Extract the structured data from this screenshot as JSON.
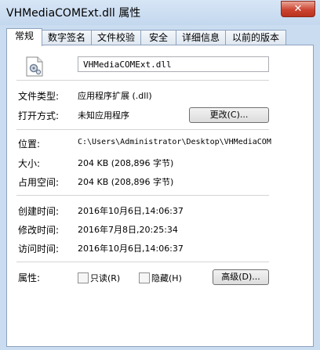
{
  "window": {
    "title": "VHMediaCOMExt.dll 属性",
    "close_label": "✕"
  },
  "tabs": [
    {
      "label": "常规"
    },
    {
      "label": "数字签名"
    },
    {
      "label": "文件校验"
    },
    {
      "label": "安全"
    },
    {
      "label": "详细信息"
    },
    {
      "label": "以前的版本"
    }
  ],
  "general": {
    "filename": "VHMediaCOMExt.dll",
    "file_type_label": "文件类型:",
    "file_type_value": "应用程序扩展 (.dll)",
    "open_with_label": "打开方式:",
    "open_with_value": "未知应用程序",
    "change_button": "更改(C)...",
    "location_label": "位置:",
    "location_value": "C:\\Users\\Administrator\\Desktop\\VHMediaCOM",
    "size_label": "大小:",
    "size_value": "204 KB (208,896 字节)",
    "size_on_disk_label": "占用空间:",
    "size_on_disk_value": "204 KB (208,896 字节)",
    "created_label": "创建时间:",
    "created_value": "2016年10月6日,14:06:37",
    "modified_label": "修改时间:",
    "modified_value": "2016年7月8日,20:25:34",
    "accessed_label": "访问时间:",
    "accessed_value": "2016年10月6日,14:06:37",
    "attributes_label": "属性:",
    "readonly_label": "只读(R)",
    "hidden_label": "隐藏(H)",
    "advanced_button": "高级(D)..."
  }
}
